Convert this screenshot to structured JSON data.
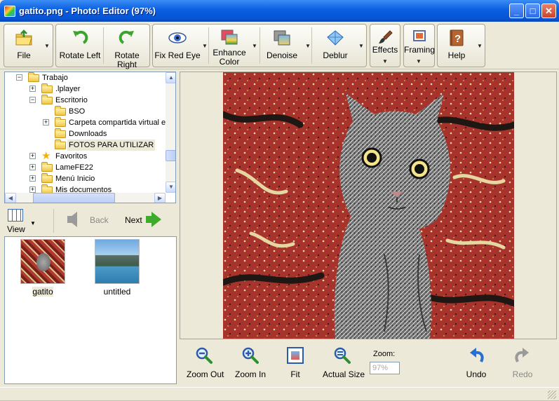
{
  "window": {
    "title": "gatito.png - Photo! Editor (97%)",
    "min_glyph": "_",
    "max_glyph": "□",
    "close_glyph": "✕"
  },
  "toolbar": {
    "file": "File",
    "rotate_left": "Rotate Left",
    "rotate_right": "Rotate Right",
    "fix_red_eye": "Fix Red Eye",
    "enhance_color_1": "Enhance",
    "enhance_color_2": "Color",
    "denoise": "Denoise",
    "deblur": "Deblur",
    "effects": "Effects",
    "framing": "Framing",
    "help": "Help",
    "dropdown_glyph": "▼"
  },
  "tree": {
    "expand_plus": "+",
    "expand_minus": "−",
    "items": [
      {
        "label": "Trabajo"
      },
      {
        "label": ".lplayer"
      },
      {
        "label": "Escritorio"
      },
      {
        "label": "BSO"
      },
      {
        "label": "Carpeta compartida virtual e"
      },
      {
        "label": "Downloads"
      },
      {
        "label": "FOTOS PARA UTILIZAR"
      },
      {
        "label": "Favoritos"
      },
      {
        "label": "LameFE22"
      },
      {
        "label": "Menú Inicio"
      },
      {
        "label": "Mis documentos"
      }
    ],
    "selected_index": 6,
    "scroll_up": "▲",
    "scroll_down": "▼",
    "scroll_left": "◀",
    "scroll_right": "▶"
  },
  "nav": {
    "view": "View",
    "back": "Back",
    "next": "Next",
    "dropdown_glyph": "▼"
  },
  "thumbnails": [
    {
      "caption": "gatito",
      "selected": true
    },
    {
      "caption": "untitled",
      "selected": false
    }
  ],
  "bottom": {
    "zoom_out": "Zoom Out",
    "zoom_in": "Zoom In",
    "fit": "Fit",
    "actual_size": "Actual Size",
    "zoom_label": "Zoom:",
    "zoom_value": "97%",
    "undo": "Undo",
    "redo": "Redo"
  },
  "colors": {
    "title_blue": "#0a5fe0",
    "face": "#ece9d8",
    "accent_green": "#3fab2d",
    "photo_red": "#9c2f2a"
  }
}
